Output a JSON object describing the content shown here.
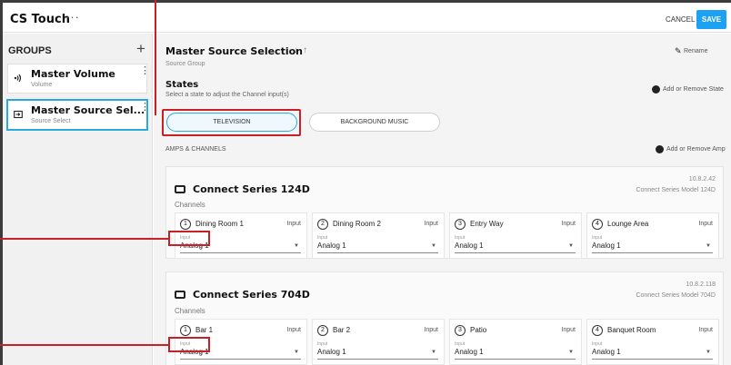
{
  "topbar": {
    "title": "CS Touch",
    "more": "···",
    "cancel": "CANCEL",
    "save": "SAVE"
  },
  "sidebar": {
    "groups_label": "GROUPS",
    "add": "+",
    "items": [
      {
        "title": "Master Volume",
        "subtitle": "Volume",
        "icon": "volume-icon"
      },
      {
        "title": "Master Source Sel...",
        "subtitle": "Source Select",
        "icon": "source-icon"
      }
    ]
  },
  "main": {
    "title": "Master Source Selection",
    "arrows": "↓↑",
    "subtitle": "Source Group",
    "rename": "Rename",
    "states_title": "States",
    "states_sub": "Select a state to adjust the Channel input(s)",
    "add_state": "Add or Remove State",
    "state_tabs": [
      "TELEVISION",
      "BACKGROUND MUSIC"
    ],
    "amps_label": "AMPS & CHANNELS",
    "add_amp": "Add or Remove Amp"
  },
  "amps": [
    {
      "title": "Connect Series 124D",
      "ip": "10.8.2.42",
      "model": "Connect Series Model 124D",
      "channels_label": "Channels",
      "channels": [
        {
          "num": "1",
          "name": "Dining Room 1",
          "type": "Input",
          "input_label": "Input",
          "value": "Analog 1"
        },
        {
          "num": "2",
          "name": "Dining Room 2",
          "type": "Input",
          "input_label": "Input",
          "value": "Analog 1"
        },
        {
          "num": "3",
          "name": "Entry Way",
          "type": "Input",
          "input_label": "Input",
          "value": "Analog 1"
        },
        {
          "num": "4",
          "name": "Lounge Area",
          "type": "Input",
          "input_label": "Input",
          "value": "Analog 1"
        }
      ]
    },
    {
      "title": "Connect Series 704D",
      "ip": "10.8.2.118",
      "model": "Connect Series Model 704D",
      "channels_label": "Channels",
      "channels": [
        {
          "num": "1",
          "name": "Bar 1",
          "type": "Input",
          "input_label": "Input",
          "value": "Analog 1"
        },
        {
          "num": "2",
          "name": "Bar 2",
          "type": "Input",
          "input_label": "Input",
          "value": "Analog 1"
        },
        {
          "num": "3",
          "name": "Patio",
          "type": "Input",
          "input_label": "Input",
          "value": "Analog 1"
        },
        {
          "num": "4",
          "name": "Banquet Room",
          "type": "Input",
          "input_label": "Input",
          "value": "Analog 1"
        }
      ]
    }
  ],
  "colors": {
    "accent": "#1da1f2",
    "callout": "#c91f26"
  }
}
